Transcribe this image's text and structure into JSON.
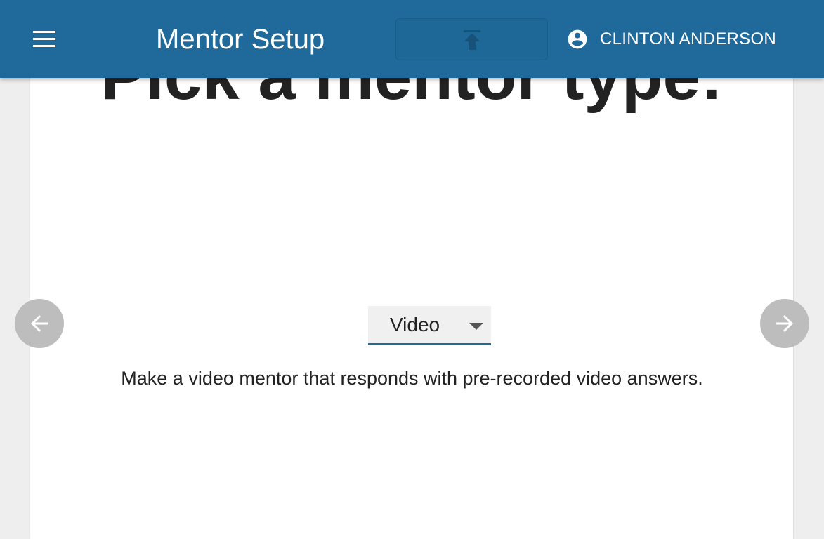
{
  "app_bar": {
    "title": "Mentor Setup",
    "user_name": "CLINTON ANDERSON",
    "color": "#1f6a9a",
    "menu_icon": "menu-icon",
    "upload_icon": "upload-icon",
    "account_icon": "account-circle-icon"
  },
  "slide": {
    "title": "Pick a mentor type:",
    "select_value": "Video",
    "description": "Make a video mentor that responds with pre-recorded video answers."
  },
  "navigation": {
    "prev_icon": "arrow-back-icon",
    "next_icon": "arrow-forward-icon"
  }
}
